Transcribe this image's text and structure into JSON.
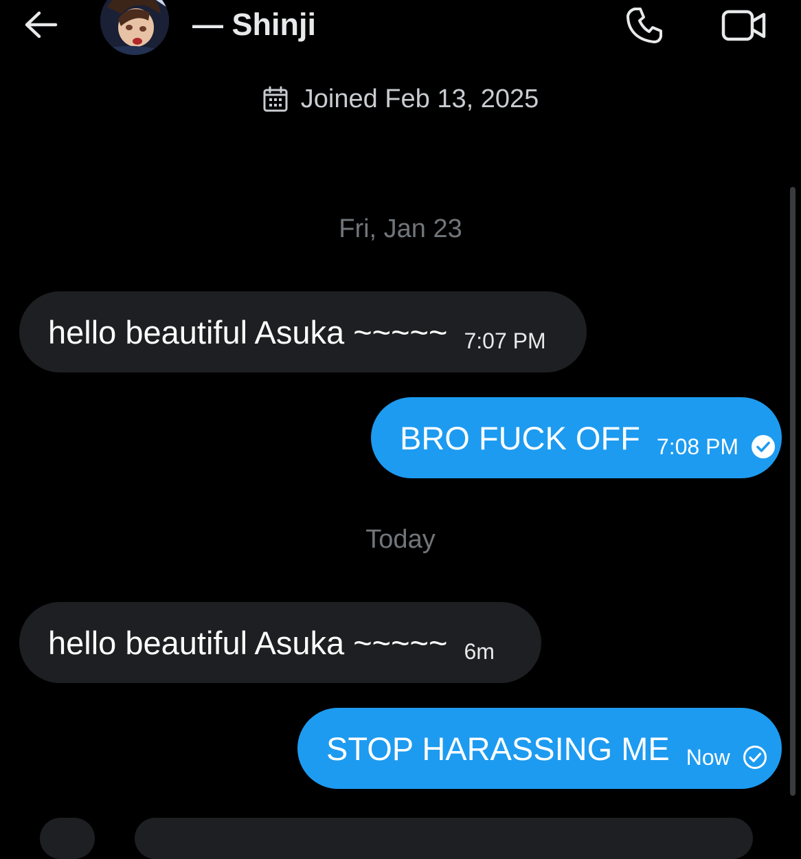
{
  "header": {
    "contact_name": "— Shinji",
    "back_icon": "arrow-left-icon",
    "call_icon": "phone-icon",
    "video_icon": "video-camera-icon"
  },
  "profile": {
    "joined_text": "Joined Feb 13, 2025",
    "joined_icon": "calendar-icon"
  },
  "conversation": {
    "sections": [
      {
        "date_label": "Fri, Jan 23",
        "messages": [
          {
            "direction": "incoming",
            "text": "hello beautiful Asuka ~~~~~",
            "time": "7:07 PM"
          },
          {
            "direction": "outgoing",
            "text": "BRO FUCK OFF",
            "time": "7:08 PM",
            "status_icon": "check-circle-filled-icon"
          }
        ]
      },
      {
        "date_label": "Today",
        "messages": [
          {
            "direction": "incoming",
            "text": "hello beautiful Asuka ~~~~~",
            "time": "6m"
          },
          {
            "direction": "outgoing",
            "text": "STOP HARASSING ME",
            "time": "Now",
            "status_icon": "check-circle-outline-icon"
          }
        ]
      }
    ]
  },
  "colors": {
    "background": "#000000",
    "incoming_bubble": "#1e1f22",
    "outgoing_bubble": "#1d9bf0",
    "date_separator": "#71767b",
    "text_primary": "#ffffff"
  }
}
